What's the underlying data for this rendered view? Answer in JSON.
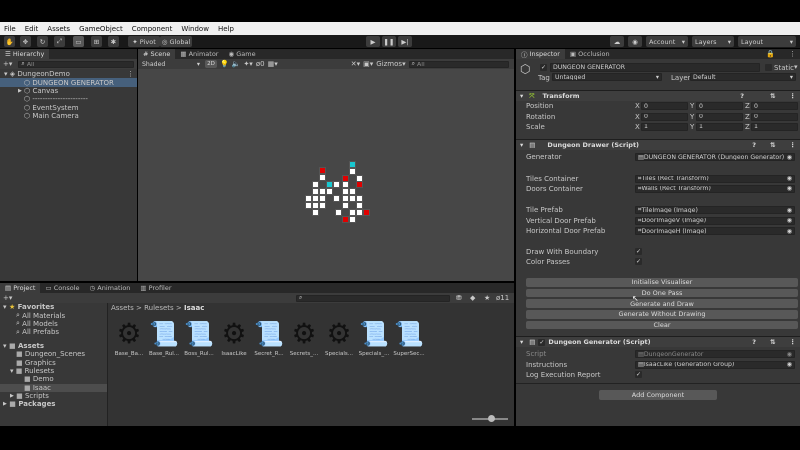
{
  "menu": [
    "File",
    "Edit",
    "Assets",
    "GameObject",
    "Component",
    "Window",
    "Help"
  ],
  "toolbar": {
    "pivot": "Pivot",
    "global": "Global",
    "account": "Account",
    "layers": "Layers",
    "layout": "Layout"
  },
  "hierarchy": {
    "tab": "Hierarchy",
    "search": "All",
    "items": [
      "DungeonDemo",
      "DUNGEON GENERATOR",
      "Canvas",
      "----------------------",
      "EventSystem",
      "Main Camera"
    ]
  },
  "scene": {
    "tabs": [
      "Scene",
      "Animator",
      "Game"
    ],
    "shading": "Shaded",
    "mode": "2D",
    "gizmos": "Gizmos",
    "search": "All",
    "hidden_count": "0"
  },
  "project": {
    "tabs": [
      "Project",
      "Console",
      "Animation",
      "Profiler"
    ],
    "favorites_label": "Favorites",
    "favorites": [
      "All Materials",
      "All Models",
      "All Prefabs"
    ],
    "assets_label": "Assets",
    "tree": [
      "Dungeon_Scenes",
      "Graphics",
      "Rulesets",
      "Demo",
      "Isaac",
      "Scripts"
    ],
    "packages_label": "Packages",
    "breadcrumb": [
      "Assets",
      "Rulesets",
      "Isaac"
    ],
    "hidden_count": "11",
    "files": [
      "Base_Ba...",
      "Base_Rul...",
      "Boss_Rul...",
      "IsaacLike",
      "Secret_R...",
      "Secrets_...",
      "Specials...",
      "Specials_...",
      "SuperSec..."
    ]
  },
  "inspector": {
    "tabs": [
      "Inspector",
      "Occlusion"
    ],
    "object_name": "DUNGEON GENERATOR",
    "static_label": "Static",
    "tag_label": "Tag",
    "tag": "Untagged",
    "layer_label": "Layer",
    "layer": "Default",
    "transform": {
      "title": "Transform",
      "rows": [
        {
          "label": "Position",
          "x": "0",
          "y": "0",
          "z": "0"
        },
        {
          "label": "Rotation",
          "x": "0",
          "y": "0",
          "z": "0"
        },
        {
          "label": "Scale",
          "x": "1",
          "y": "1",
          "z": "1"
        }
      ]
    },
    "drawer": {
      "title": "Dungeon Drawer (Script)",
      "generator_label": "Generator",
      "generator": "DUNGEON GENERATOR (Dungeon Generator)",
      "tiles_label": "Tiles Container",
      "tiles": "Tiles (Rect Transform)",
      "doors_label": "Doors Container",
      "doors": "Walls (Rect Transform)",
      "tile_prefab_label": "Tile Prefab",
      "tile_prefab": "TileImage (Image)",
      "vdoor_label": "Vertical Door Prefab",
      "vdoor": "DoorImageV (Image)",
      "hdoor_label": "Horizontal Door Prefab",
      "hdoor": "DoorImageH (Image)",
      "boundary_label": "Draw With Boundary",
      "color_label": "Color Passes",
      "buttons": [
        "Initialise Visualiser",
        "Do One Pass",
        "Generate and Draw",
        "Generate Without Drawing",
        "Clear"
      ]
    },
    "generator": {
      "title": "Dungeon Generator (Script)",
      "script_label": "Script",
      "script": "DungeonGenerator",
      "instructions_label": "Instructions",
      "instructions": "IsaacLike (Generation Group)",
      "log_label": "Log Execution Report"
    },
    "add_component": "Add Component"
  }
}
